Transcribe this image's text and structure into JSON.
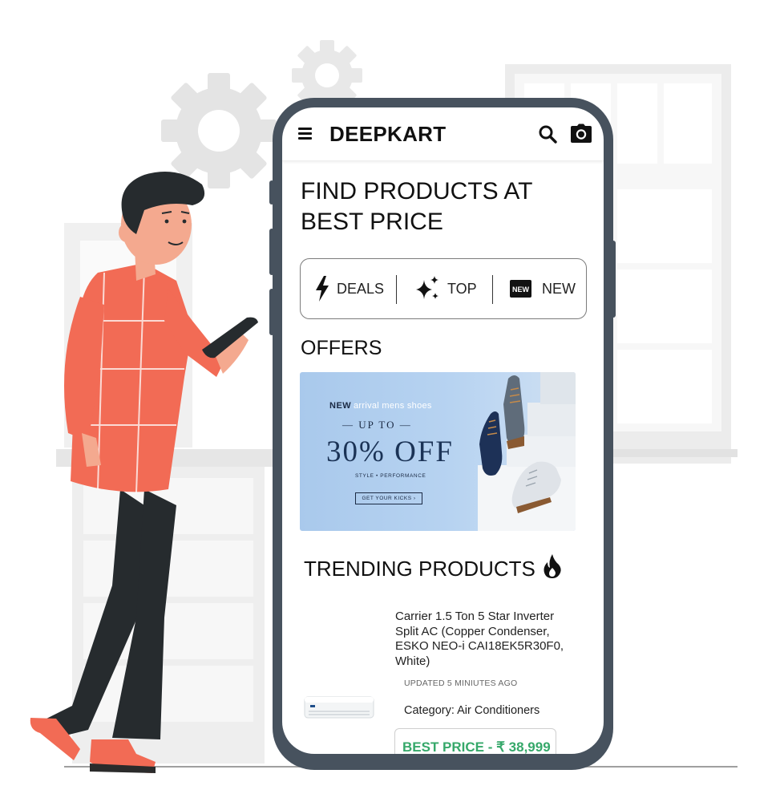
{
  "app": {
    "brand": "DEEPKART",
    "headline_line1": "FIND PRODUCTS AT",
    "headline_line2": "BEST PRICE"
  },
  "appbar": {
    "menu_icon": "hamburger-menu-icon",
    "search_icon": "search-icon",
    "camera_icon": "camera-icon"
  },
  "quick_filters": [
    {
      "label": "DEALS",
      "icon": "lightning-bolt-icon"
    },
    {
      "label": "TOP",
      "icon": "sparkles-icon"
    },
    {
      "label": "NEW",
      "icon": "new-badge-icon",
      "badge_text": "NEW"
    }
  ],
  "offers": {
    "title": "OFFERS",
    "banner": {
      "new": "NEW",
      "arrival": "arrival mens shoes",
      "up_to": "— UP TO —",
      "discount": "30% OFF",
      "tagline": "STYLE • PERFORMANCE",
      "cta": "GET YOUR KICKS ›"
    }
  },
  "trending": {
    "title": "TRENDING PRODUCTS",
    "icon": "fire-icon",
    "product": {
      "name": "Carrier 1.5 Ton 5 Star Inverter Split AC (Copper Condenser, ESKO NEO-i CAI18EK5R30F0, White)",
      "updated": "UPDATED 5 MINIUTES AGO",
      "category": "Category: Air Conditioners",
      "price": "BEST PRICE - ₹ 38,999"
    }
  },
  "colors": {
    "phone_frame": "#47525e",
    "price_green": "#36a86a",
    "shirt": "#f26b55",
    "pants": "#262b2e"
  }
}
